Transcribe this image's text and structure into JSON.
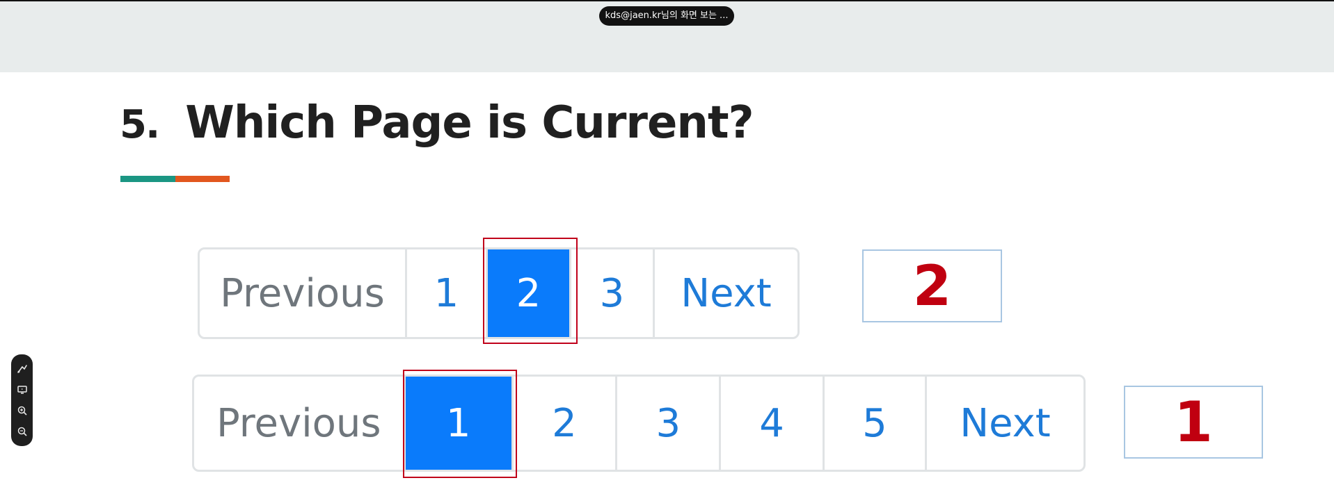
{
  "share_banner": {
    "text": "kds@jaen.kr님의 화면 보는 ..."
  },
  "slide": {
    "number": "5.",
    "title": "Which Page is Current?"
  },
  "colors": {
    "accent_teal": "#1b9683",
    "accent_orange": "#e2571f",
    "active_page": "#0a7bfb",
    "link_blue": "#1e7bd8",
    "highlight_red": "#c0001a",
    "answer_red": "#c00010"
  },
  "pagination_1": {
    "items": [
      "Previous",
      "1",
      "2",
      "3",
      "Next"
    ],
    "active": "2",
    "answer": "2"
  },
  "pagination_2": {
    "items": [
      "Previous",
      "1",
      "2",
      "3",
      "4",
      "5",
      "Next"
    ],
    "active": "1",
    "answer": "1"
  },
  "toolbar": {
    "icons": [
      "pen-icon",
      "screen-share-icon",
      "zoom-in-icon",
      "zoom-out-icon"
    ]
  }
}
